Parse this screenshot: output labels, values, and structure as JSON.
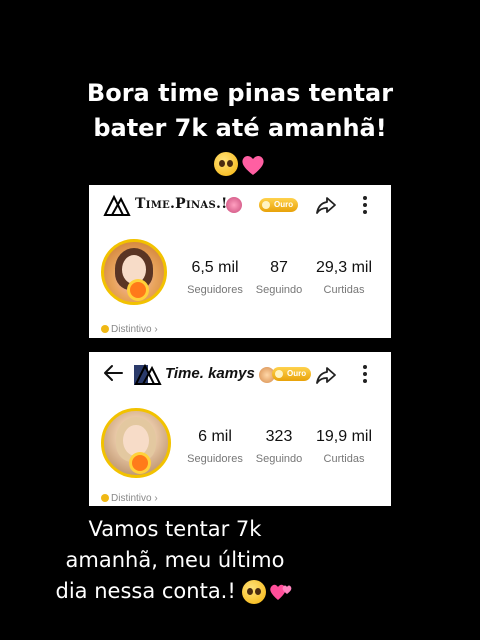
{
  "captions": {
    "top_line1": "Bora time pinas tentar",
    "top_line2": "bater 7k até amanhã!",
    "bottom_line1": "Vamos tentar 7k",
    "bottom_line2": "amanhã, meu último",
    "bottom_line3": "dia nessa conta.!"
  },
  "emoji": {
    "top": [
      "pleading-face",
      "pink-heart"
    ],
    "bottom": [
      "pleading-face",
      "two-hearts"
    ]
  },
  "profiles": [
    {
      "username": "Time.Pinas.!",
      "badge": "Ouro",
      "stats": [
        {
          "value": "6,5 mil",
          "label": "Seguidores"
        },
        {
          "value": "87",
          "label": "Seguindo"
        },
        {
          "value": "29,3 mil",
          "label": "Curtidas"
        }
      ],
      "distintivo": "Distintivo"
    },
    {
      "username": "Time. kamys",
      "badge": "Ouro",
      "stats": [
        {
          "value": "6 mil",
          "label": "Seguidores"
        },
        {
          "value": "323",
          "label": "Seguindo"
        },
        {
          "value": "19,9 mil",
          "label": "Curtidas"
        }
      ],
      "distintivo": "Distintivo"
    }
  ],
  "colors": {
    "background": "#000000",
    "badge_gold": "#e8a20a",
    "avatar_ring": "#f2c200"
  }
}
